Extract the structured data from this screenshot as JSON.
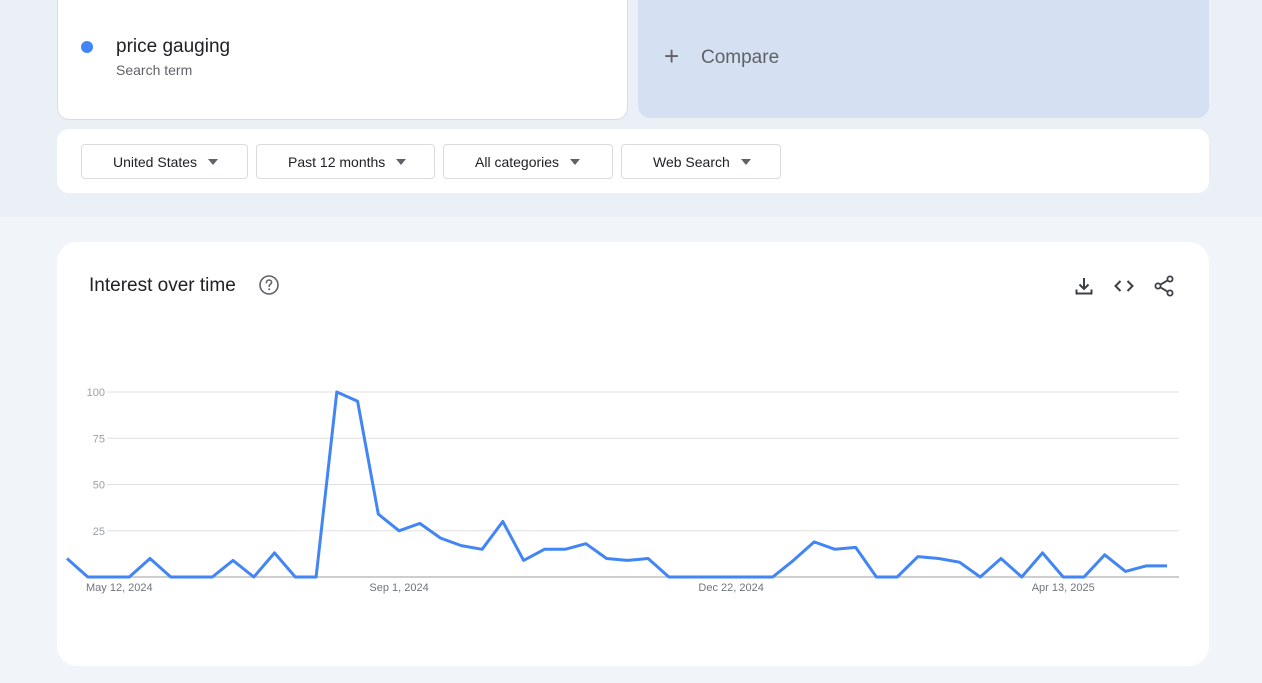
{
  "search_term": {
    "name": "price gauging",
    "subtitle": "Search term",
    "dot_color": "#4285f4"
  },
  "compare": {
    "label": "Compare",
    "icon": "plus-icon"
  },
  "filters": [
    {
      "label": "United States"
    },
    {
      "label": "Past 12 months"
    },
    {
      "label": "All categories"
    },
    {
      "label": "Web Search"
    }
  ],
  "chart_card": {
    "title": "Interest over time",
    "icons": [
      "help-icon",
      "download-icon",
      "embed-code-icon",
      "share-icon"
    ]
  },
  "chart_data": {
    "type": "line",
    "series_color": "#4285f4",
    "grid": true,
    "ylim": [
      0,
      100
    ],
    "y_ticks": [
      "100",
      "75",
      "50",
      "25"
    ],
    "x_tick_labels": [
      {
        "label": "May 12, 2024",
        "index": 0
      },
      {
        "label": "Sep 1, 2024",
        "index": 16
      },
      {
        "label": "Dec 22, 2024",
        "index": 32
      },
      {
        "label": "Apr 13, 2025",
        "index": 48
      }
    ],
    "x": [
      "2024-05-12",
      "2024-05-19",
      "2024-05-26",
      "2024-06-02",
      "2024-06-09",
      "2024-06-16",
      "2024-06-23",
      "2024-06-30",
      "2024-07-07",
      "2024-07-14",
      "2024-07-21",
      "2024-07-28",
      "2024-08-04",
      "2024-08-11",
      "2024-08-18",
      "2024-08-25",
      "2024-09-01",
      "2024-09-08",
      "2024-09-15",
      "2024-09-22",
      "2024-09-29",
      "2024-10-06",
      "2024-10-13",
      "2024-10-20",
      "2024-10-27",
      "2024-11-03",
      "2024-11-10",
      "2024-11-17",
      "2024-11-24",
      "2024-12-01",
      "2024-12-08",
      "2024-12-15",
      "2024-12-22",
      "2024-12-29",
      "2025-01-05",
      "2025-01-12",
      "2025-01-19",
      "2025-01-26",
      "2025-02-02",
      "2025-02-09",
      "2025-02-16",
      "2025-02-23",
      "2025-03-02",
      "2025-03-09",
      "2025-03-16",
      "2025-03-23",
      "2025-03-30",
      "2025-04-06",
      "2025-04-13",
      "2025-04-20",
      "2025-04-27",
      "2025-05-04",
      "2025-05-11"
    ],
    "values": [
      10,
      0,
      0,
      0,
      10,
      0,
      0,
      0,
      9,
      0,
      13,
      0,
      0,
      100,
      95,
      34,
      25,
      29,
      21,
      17,
      15,
      30,
      9,
      15,
      15,
      18,
      10,
      9,
      10,
      0,
      0,
      0,
      0,
      0,
      0,
      9,
      19,
      15,
      16,
      0,
      0,
      11,
      10,
      8,
      0,
      10,
      0,
      13,
      0,
      0,
      12,
      3,
      6,
      6
    ]
  }
}
